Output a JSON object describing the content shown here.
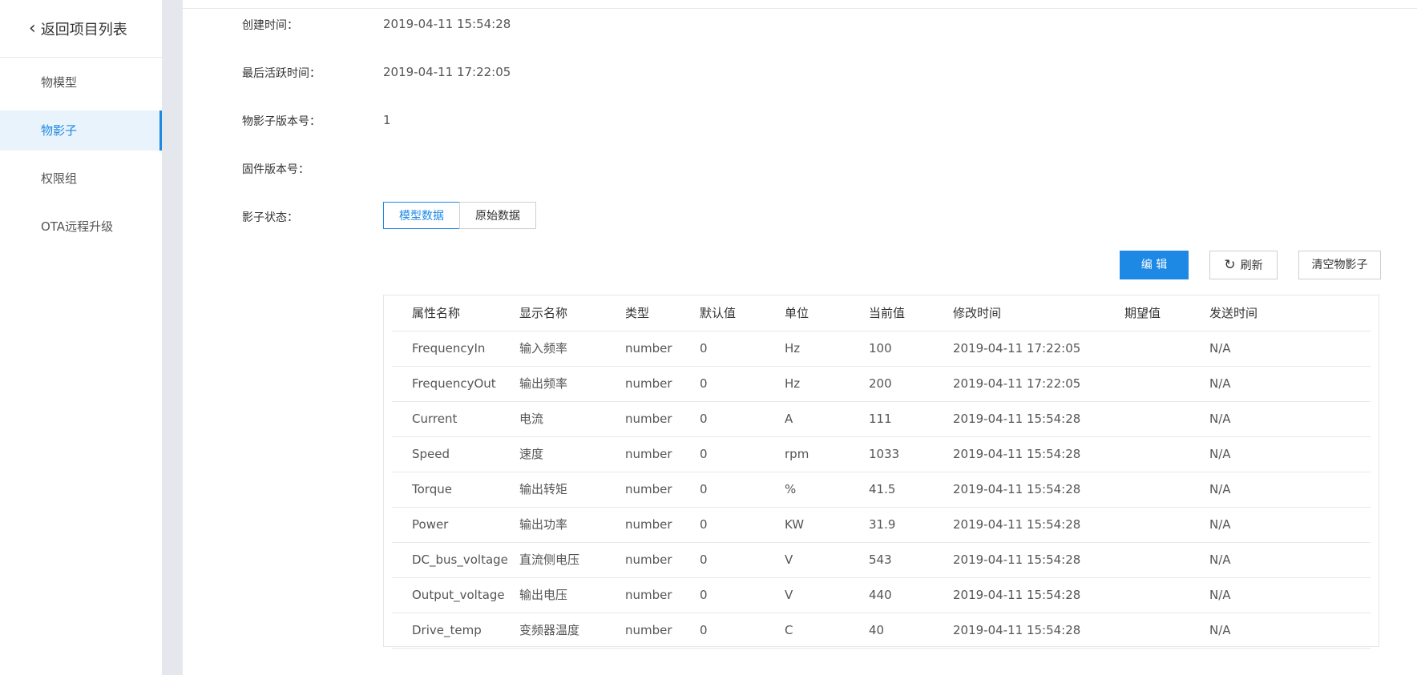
{
  "sidebar": {
    "back_label": "返回项目列表",
    "items": [
      {
        "label": "物模型"
      },
      {
        "label": "物影子"
      },
      {
        "label": "权限组"
      },
      {
        "label": "OTA远程升级"
      }
    ]
  },
  "info": {
    "created_label": "创建时间：",
    "created_value": "2019-04-11 15:54:28",
    "last_active_label": "最后活跃时间：",
    "last_active_value": "2019-04-11 17:22:05",
    "shadow_version_label": "物影子版本号：",
    "shadow_version_value": "1",
    "firmware_label": "固件版本号：",
    "firmware_value": "",
    "shadow_state_label": "影子状态："
  },
  "tabs": [
    {
      "label": "模型数据"
    },
    {
      "label": "原始数据"
    }
  ],
  "actions": {
    "edit_label": "编 辑",
    "refresh_label": "刷新",
    "clear_label": "清空物影子"
  },
  "table": {
    "headers": [
      "属性名称",
      "显示名称",
      "类型",
      "默认值",
      "单位",
      "当前值",
      "修改时间",
      "期望值",
      "发送时间"
    ],
    "rows": [
      [
        "FrequencyIn",
        "输入频率",
        "number",
        "0",
        "Hz",
        "100",
        "2019-04-11 17:22:05",
        "",
        "N/A"
      ],
      [
        "FrequencyOut",
        "输出频率",
        "number",
        "0",
        "Hz",
        "200",
        "2019-04-11 17:22:05",
        "",
        "N/A"
      ],
      [
        "Current",
        "电流",
        "number",
        "0",
        "A",
        "111",
        "2019-04-11 15:54:28",
        "",
        "N/A"
      ],
      [
        "Speed",
        "速度",
        "number",
        "0",
        "rpm",
        "1033",
        "2019-04-11 15:54:28",
        "",
        "N/A"
      ],
      [
        "Torque",
        "输出转矩",
        "number",
        "0",
        "%",
        "41.5",
        "2019-04-11 15:54:28",
        "",
        "N/A"
      ],
      [
        "Power",
        "输出功率",
        "number",
        "0",
        "KW",
        "31.9",
        "2019-04-11 15:54:28",
        "",
        "N/A"
      ],
      [
        "DC_bus_voltage",
        "直流侧电压",
        "number",
        "0",
        "V",
        "543",
        "2019-04-11 15:54:28",
        "",
        "N/A"
      ],
      [
        "Output_voltage",
        "输出电压",
        "number",
        "0",
        "V",
        "440",
        "2019-04-11 15:54:28",
        "",
        "N/A"
      ],
      [
        "Drive_temp",
        "变频器温度",
        "number",
        "0",
        "C",
        "40",
        "2019-04-11 15:54:28",
        "",
        "N/A"
      ]
    ]
  },
  "colors": {
    "accent": "#1e88e5",
    "active_bg": "#e8f3fc",
    "gray_band": "#e4e7ec"
  }
}
